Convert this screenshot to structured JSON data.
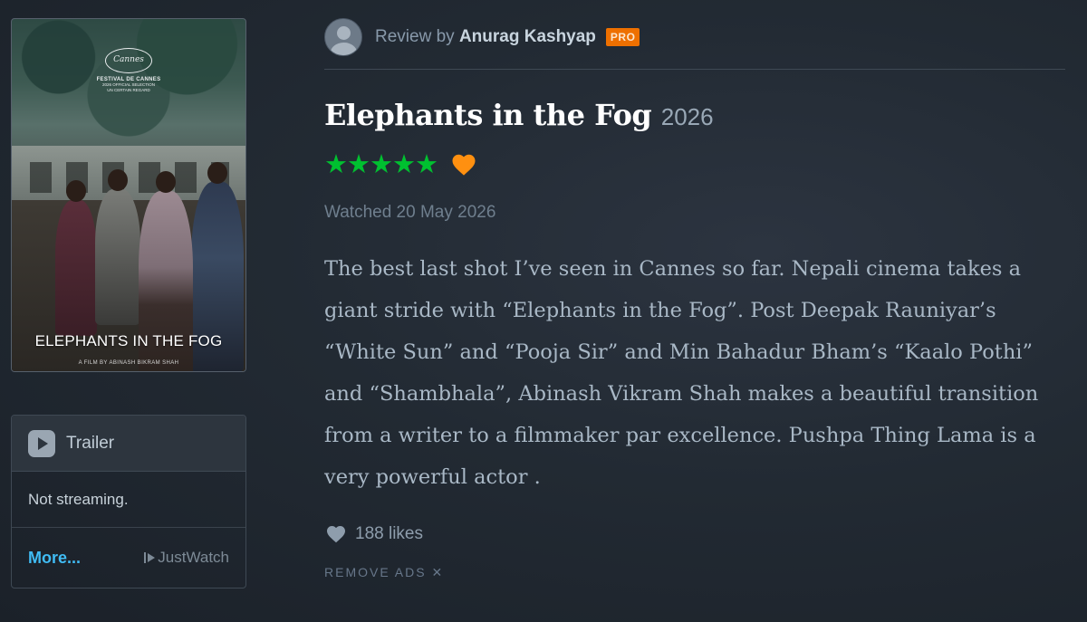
{
  "poster": {
    "festival_logo_text": "Cannes",
    "festival_name": "FESTIVAL DE CANNES",
    "festival_line1": "2026 OFFICIAL SELECTION",
    "festival_line2": "UN CERTAIN REGARD",
    "title": "ELEPHANTS IN THE FOG",
    "credit": "A FILM BY ABINASH BIKRAM SHAH"
  },
  "watch": {
    "trailer_label": "Trailer",
    "streaming_status": "Not streaming.",
    "more_label": "More...",
    "provider_label": "JustWatch"
  },
  "review": {
    "by_prefix": "Review by",
    "reviewer_name": "Anurag Kashyap",
    "badge": "PRO",
    "film_title": "Elephants in the Fog",
    "film_year": "2026",
    "rating_stars": "★★★★★",
    "rating_value": 5,
    "liked": true,
    "watched_text": "Watched 20 May 2026",
    "body": "The best last shot I’ve seen in Cannes so far. Nepali cinema takes a giant stride with “Elephants in the Fog”. Post Deepak Rauniyar’s “White Sun” and “Pooja Sir” and Min Bahadur Bham’s “Kaalo Pothi” and “Shambhala”, Abinash Vikram Shah makes a beautiful transition from a writer to a filmmaker par excellence. Pushpa Thing Lama is a very powerful actor .",
    "likes_count": "188 likes",
    "remove_ads": "REMOVE ADS ✕"
  },
  "colors": {
    "star_green": "#00c030",
    "heart_orange": "#ff9010",
    "pro_orange": "#ee7000",
    "link_blue": "#40bcf4"
  },
  "icons": [
    "avatar-icon",
    "star-icon",
    "heart-icon",
    "play-icon",
    "justwatch-icon",
    "close-icon"
  ]
}
